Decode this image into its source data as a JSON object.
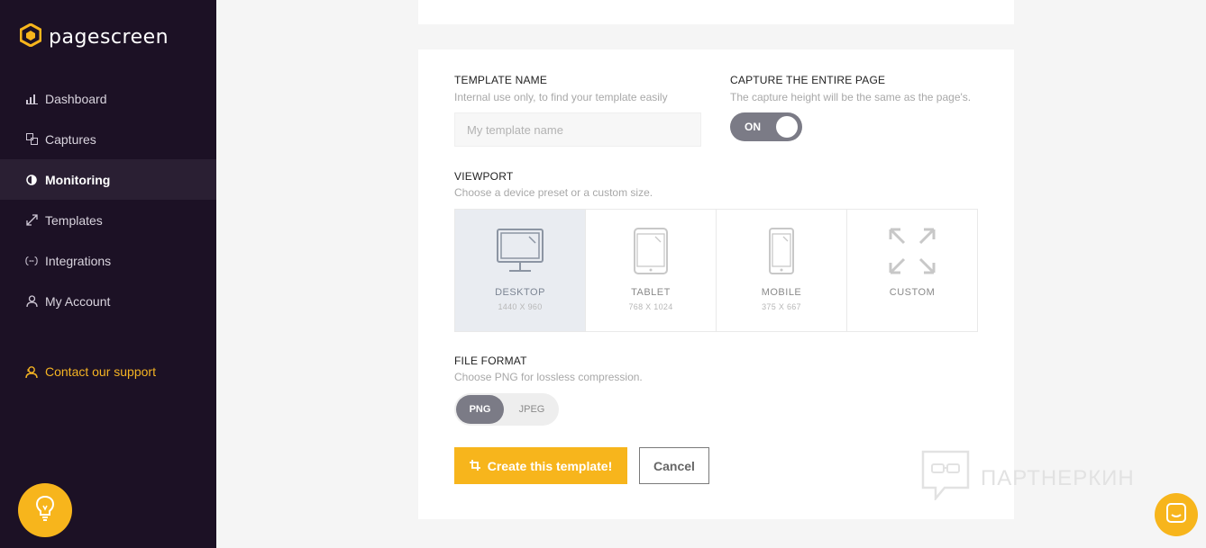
{
  "app": {
    "logo_text": "pagescreen",
    "accent": "#f7b51c",
    "sidebar_bg": "#1c1125"
  },
  "sidebar": {
    "items": [
      {
        "label": "Dashboard",
        "icon": "bar-chart-icon"
      },
      {
        "label": "Captures",
        "icon": "captures-icon"
      },
      {
        "label": "Monitoring",
        "icon": "half-circle-icon",
        "active": true
      },
      {
        "label": "Templates",
        "icon": "expand-icon"
      },
      {
        "label": "Integrations",
        "icon": "code-brackets-icon"
      },
      {
        "label": "My Account",
        "icon": "user-icon"
      }
    ],
    "support_label": "Contact our support"
  },
  "form": {
    "template_name": {
      "label": "TEMPLATE NAME",
      "hint": "Internal use only, to find your template easily",
      "placeholder": "My template name",
      "value": ""
    },
    "capture_entire": {
      "label": "CAPTURE THE ENTIRE PAGE",
      "hint": "The capture height will be the same as the page's.",
      "toggle_label": "ON",
      "state": "on"
    },
    "viewport": {
      "label": "VIEWPORT",
      "hint": "Choose a device preset or a custom size.",
      "options": [
        {
          "name": "DESKTOP",
          "dims": "1440 X 960",
          "icon": "desktop-icon",
          "selected": true
        },
        {
          "name": "TABLET",
          "dims": "768 X 1024",
          "icon": "tablet-icon"
        },
        {
          "name": "MOBILE",
          "dims": "375 X 667",
          "icon": "mobile-icon"
        },
        {
          "name": "CUSTOM",
          "dims": "",
          "icon": "custom-size-icon"
        }
      ]
    },
    "file_format": {
      "label": "FILE FORMAT",
      "hint": "Choose PNG for lossless compression.",
      "options": [
        "PNG",
        "JPEG"
      ],
      "selected": "PNG"
    },
    "create_label": "Create this template!",
    "cancel_label": "Cancel"
  },
  "watermark_text": "ПАРТНЕРКИН"
}
